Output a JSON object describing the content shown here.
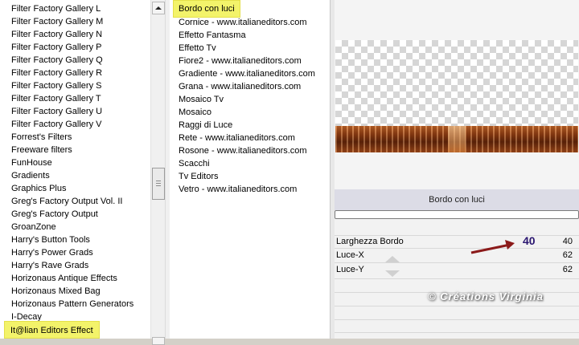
{
  "categories": {
    "items": [
      "Filter Factory Gallery L",
      "Filter Factory Gallery M",
      "Filter Factory Gallery N",
      "Filter Factory Gallery P",
      "Filter Factory Gallery Q",
      "Filter Factory Gallery R",
      "Filter Factory Gallery S",
      "Filter Factory Gallery T",
      "Filter Factory Gallery U",
      "Filter Factory Gallery V",
      "Forrest's Filters",
      "Freeware filters",
      "FunHouse",
      "Gradients",
      "Graphics Plus",
      "Greg's Factory Output Vol. II",
      "Greg's Factory Output",
      "GroanZone",
      "Harry's Button Tools",
      "Harry's Power Grads",
      "Harry's Rave Grads",
      "Horizonaus Antique Effects",
      "Horizonaus Mixed Bag",
      "Horizonaus Pattern Generators",
      "I-Decay"
    ],
    "selected": "It@lian Editors Effect"
  },
  "effects": {
    "selected": "Bordo con luci",
    "items": [
      "Cornice - www.italianeditors.com",
      "Effetto Fantasma",
      "Effetto Tv",
      "Fiore2 - www.italianeditors.com",
      "Gradiente - www.italianeditors.com",
      "Grana - www.italianeditors.com",
      "Mosaico Tv",
      "Mosaico",
      "Raggi di Luce",
      "Rete - www.italianeditors.com",
      "Rosone - www.italianeditors.com",
      "Scacchi",
      "Tv Editors",
      "Vetro - www.italianeditors.com"
    ]
  },
  "settings": {
    "title": "Bordo con luci",
    "params": [
      {
        "label": "Larghezza Bordo",
        "value": "40"
      },
      {
        "label": "Luce-X",
        "value": "62"
      },
      {
        "label": "Luce-Y",
        "value": "62"
      }
    ]
  },
  "annotation": {
    "value": "40",
    "arrow_color": "#8b1a1a",
    "value_color": "#2a1670"
  },
  "watermark": "© Créations Virginia",
  "colors": {
    "highlight": "#f3f36a",
    "panel": "#f2f2f2"
  }
}
